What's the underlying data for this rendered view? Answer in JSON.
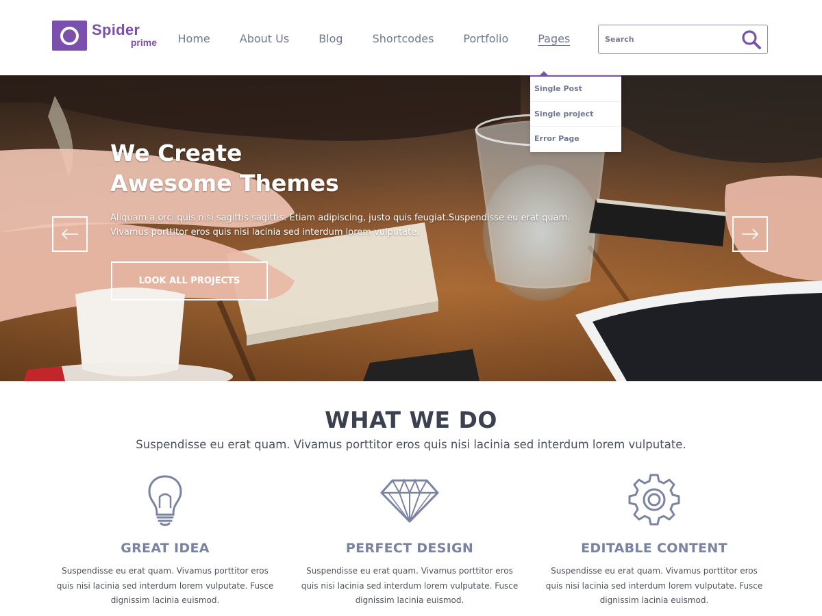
{
  "brand": {
    "name": "Spider",
    "sub": "prime",
    "color": "#7b4fae"
  },
  "nav": {
    "items": [
      {
        "label": "Home"
      },
      {
        "label": "About Us"
      },
      {
        "label": "Blog"
      },
      {
        "label": "Shortcodes"
      },
      {
        "label": "Portfolio"
      },
      {
        "label": "Pages"
      }
    ],
    "active": "Pages"
  },
  "search": {
    "placeholder": "Search",
    "value": "",
    "icon": "search-icon"
  },
  "dropdown": {
    "items": [
      {
        "label": "Single Post"
      },
      {
        "label": "Single project"
      },
      {
        "label": "Error Page"
      }
    ]
  },
  "hero": {
    "title_line1": "We Create",
    "title_line2": "Awesome Themes",
    "text": "Aliquam a orci quis nisi sagittis sagittis. Etiam adipiscing, justo quis feugiat.Suspendisse eu erat quam. Vivamus porttitor eros quis nisi lacinia sed interdum lorem vulputate.",
    "button": "LOOK ALL PROJECTS",
    "prev_icon": "arrow-left-icon",
    "next_icon": "arrow-right-icon"
  },
  "section": {
    "title": "WHAT WE DO",
    "subtitle": "Suspendisse eu erat quam. Vivamus porttitor eros quis nisi lacinia sed interdum lorem vulputate."
  },
  "features": [
    {
      "icon": "lightbulb-icon",
      "title": "GREAT IDEA",
      "text": "Suspendisse eu erat quam. Vivamus porttitor eros quis nisi lacinia sed interdum lorem vulputate. Fusce dignissim lacinia euismod."
    },
    {
      "icon": "diamond-icon",
      "title": "PERFECT DESIGN",
      "text": "Suspendisse eu erat quam. Vivamus porttitor eros quis nisi lacinia sed interdum lorem vulputate. Fusce dignissim lacinia euismod."
    },
    {
      "icon": "gear-icon",
      "title": "EDITABLE CONTENT",
      "text": "Suspendisse eu erat quam. Vivamus porttitor eros quis nisi lacinia sed interdum lorem vulputate. Fusce dignissim lacinia euismod."
    }
  ],
  "colors": {
    "accent": "#7b4fae",
    "nav_text": "#6e7892",
    "feature_title": "#7a84a2",
    "icon_stroke": "#7a84a2"
  }
}
